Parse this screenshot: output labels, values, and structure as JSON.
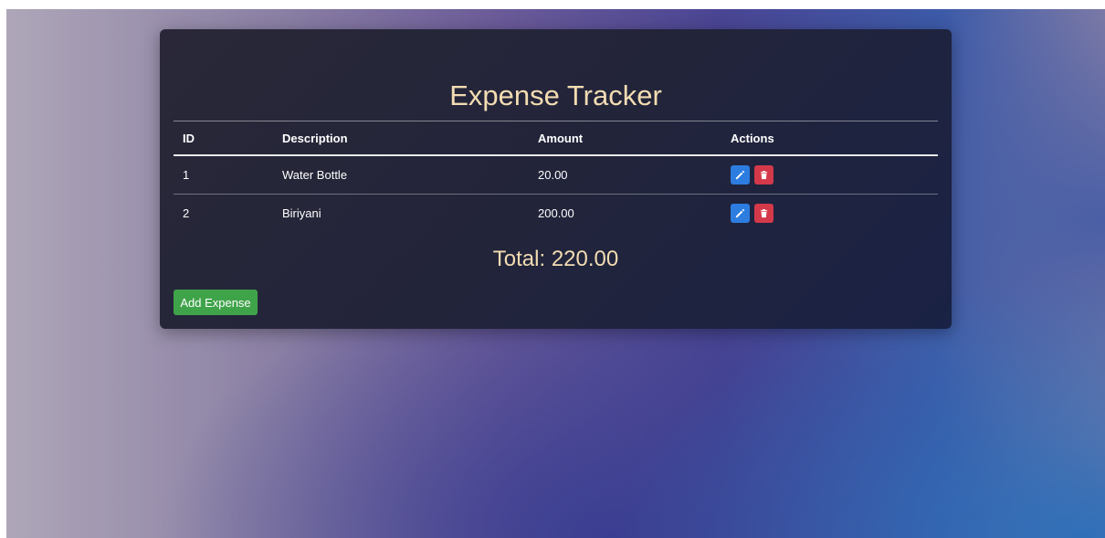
{
  "app": {
    "title": "Expense Tracker"
  },
  "table": {
    "headers": {
      "id": "ID",
      "description": "Description",
      "amount": "Amount",
      "actions": "Actions"
    },
    "rows": [
      {
        "id": "1",
        "description": "Water Bottle",
        "amount": "20.00"
      },
      {
        "id": "2",
        "description": "Biriyani",
        "amount": "200.00"
      }
    ]
  },
  "summary": {
    "total_text": "Total: 220.00"
  },
  "buttons": {
    "add_label": "Add Expense",
    "edit_icon": "pencil-icon",
    "delete_icon": "trash-icon"
  },
  "colors": {
    "title": "#f3dcb2",
    "edit": "#2d7de0",
    "delete": "#d4394a",
    "add": "#3fa34a"
  }
}
